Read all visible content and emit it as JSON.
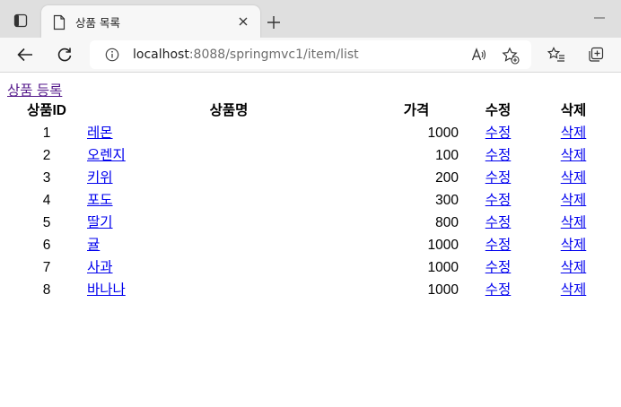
{
  "browser": {
    "tab_title": "상품 목록",
    "url_host": "localhost",
    "url_path": ":8088/springmvc1/item/list"
  },
  "page": {
    "add_link": "상품 등록",
    "headers": {
      "id": "상품ID",
      "name": "상품명",
      "price": "가격",
      "edit": "수정",
      "delete": "삭제"
    },
    "items": [
      {
        "id": "1",
        "name": "레몬",
        "price": "1000",
        "edit": "수정",
        "delete": "삭제"
      },
      {
        "id": "2",
        "name": "오렌지",
        "price": "100",
        "edit": "수정",
        "delete": "삭제"
      },
      {
        "id": "3",
        "name": "키위",
        "price": "200",
        "edit": "수정",
        "delete": "삭제"
      },
      {
        "id": "4",
        "name": "포도",
        "price": "300",
        "edit": "수정",
        "delete": "삭제"
      },
      {
        "id": "5",
        "name": "딸기",
        "price": "800",
        "edit": "수정",
        "delete": "삭제"
      },
      {
        "id": "6",
        "name": "귤",
        "price": "1000",
        "edit": "수정",
        "delete": "삭제"
      },
      {
        "id": "7",
        "name": "사과",
        "price": "1000",
        "edit": "수정",
        "delete": "삭제"
      },
      {
        "id": "8",
        "name": "바나나",
        "price": "1000",
        "edit": "수정",
        "delete": "삭제"
      }
    ]
  },
  "colors": {
    "link": "#0000ee",
    "visited_link": "#551a8b",
    "tabstrip_bg": "#dfdfdf",
    "toolbar_bg": "#f7f7f7"
  }
}
